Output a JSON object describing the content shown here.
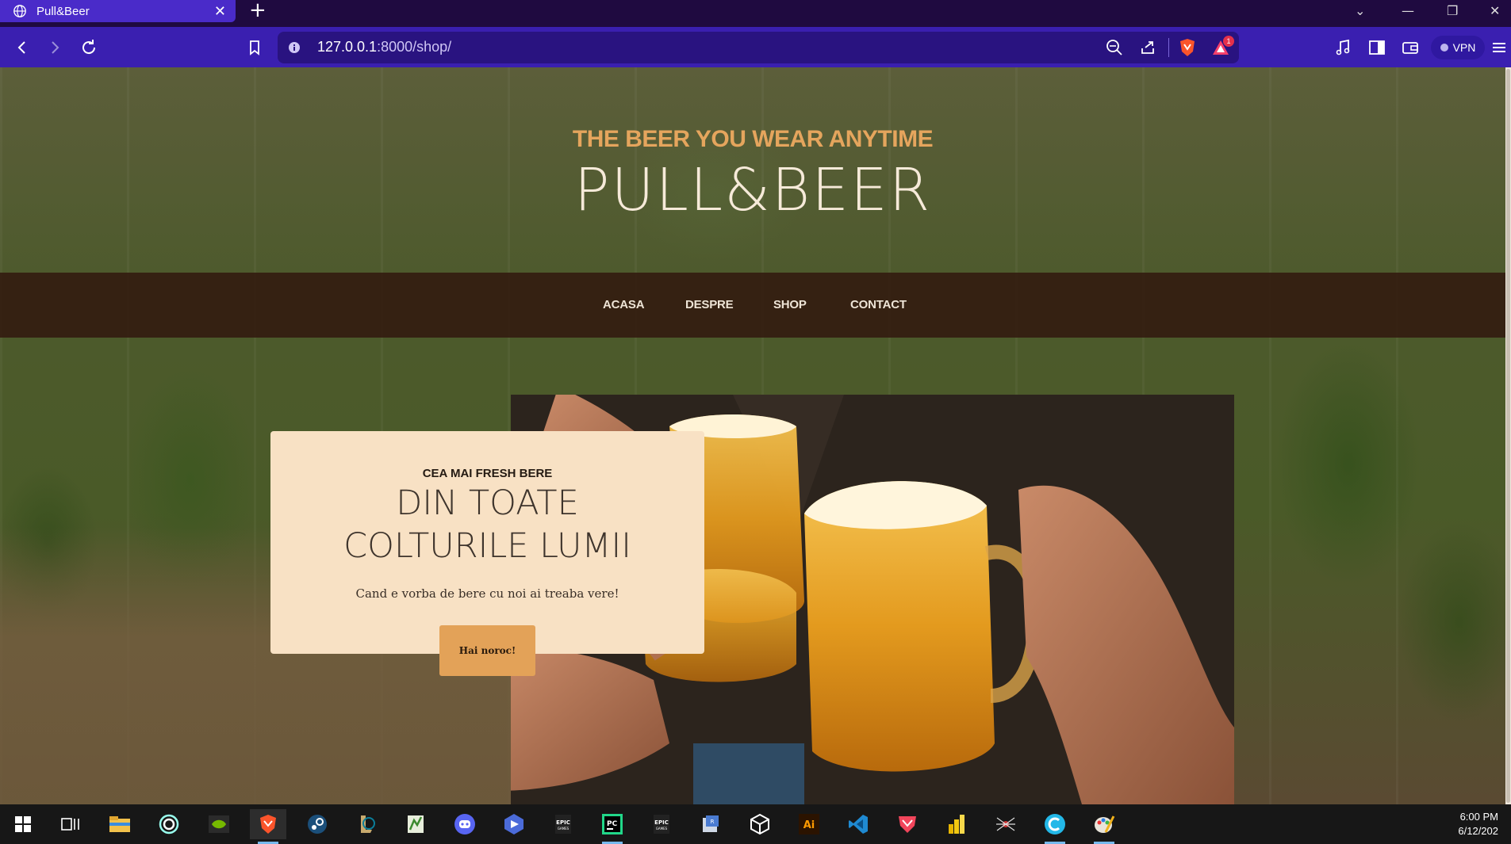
{
  "browser": {
    "tab_title": "Pull&Beer",
    "url_host": "127.0.0.1",
    "url_rest": ":8000/shop/",
    "vpn_label": "VPN",
    "alert_count": "1",
    "colors": {
      "tab_active": "#4a2bc9",
      "toolbar": "#3a1fb0",
      "titlebar": "#1f0a40"
    }
  },
  "hero": {
    "tagline": "THE BEER YOU WEAR ANYTIME",
    "title": "PULL&BEER"
  },
  "nav": {
    "items": [
      {
        "label": "ACASA"
      },
      {
        "label": "DESPRE"
      },
      {
        "label": "SHOP"
      },
      {
        "label": "CONTACT"
      }
    ]
  },
  "feature_card": {
    "kicker": "CEA MAI FRESH BERE",
    "title_line1": "DIN TOATE",
    "title_line2": "COLTURILE LUMII",
    "text": "Cand e vorba de bere cu noi ai treaba vere!",
    "button_label": "Hai noroc!"
  },
  "photo": {
    "subject": "two beer mugs clinking"
  },
  "colors": {
    "accent": "#e5a55d",
    "card_bg": "#f8e1c4",
    "nav_bg": "#32190f",
    "button_bg": "#e3a258"
  },
  "taskbar": {
    "apps": [
      "start-icon",
      "task-view-icon",
      "file-explorer-icon",
      "browser-icon",
      "nvidia-icon",
      "brave-icon",
      "steam-icon",
      "league-icon",
      "android-studio-icon",
      "discord-icon",
      "app-icon",
      "epic-games-icon",
      "pycharm-icon",
      "epic-games-icon",
      "virtualbox-icon",
      "unity-icon",
      "illustrator-icon",
      "vscode-icon",
      "shield-icon",
      "power-bi-icon",
      "spider-icon",
      "canva-icon",
      "paint-icon"
    ],
    "time": "6:00 PM",
    "date": "6/12/202"
  }
}
